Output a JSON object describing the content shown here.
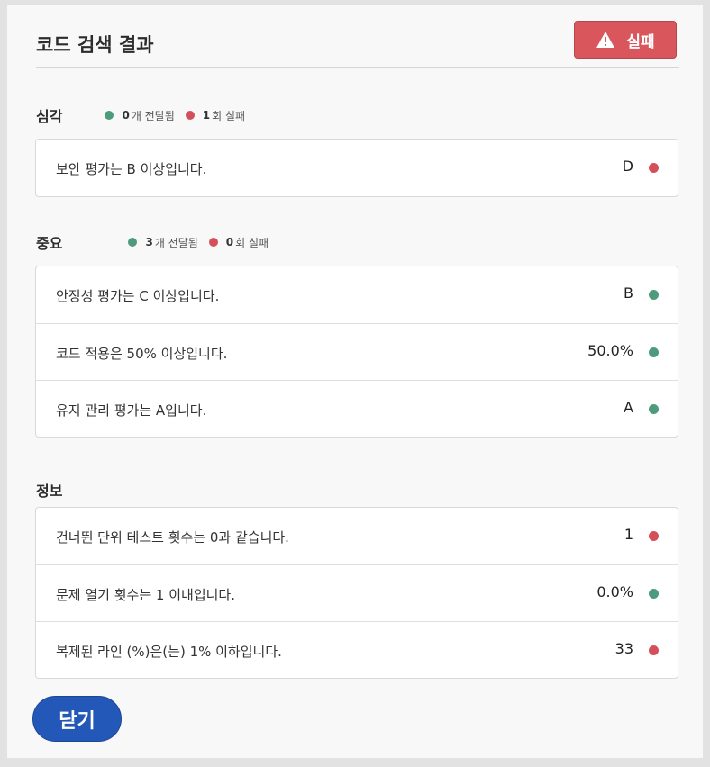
{
  "dialog": {
    "title": "코드 검색 결과",
    "status_badge": "실패",
    "close_label": "닫기"
  },
  "sections": {
    "critical": {
      "name": "심각",
      "passed_count": "0",
      "passed_text": "개 전달됨",
      "failed_count": "1",
      "failed_text": "회 실패",
      "rows": [
        {
          "label": "보안 평가는 B 이상입니다.",
          "value": "D",
          "status": "failed"
        }
      ]
    },
    "major": {
      "name": "중요",
      "passed_count": "3",
      "passed_text": " 개 전달됨",
      "failed_count": "0",
      "failed_text": " 회 실패",
      "rows": [
        {
          "label": "안정성 평가는 C 이상입니다.",
          "value": "B",
          "status": "passed"
        },
        {
          "label": "코드 적용은 50% 이상입니다.",
          "value": "50.0%",
          "status": "passed"
        },
        {
          "label": "유지 관리 평가는 A입니다.",
          "value": "A",
          "status": "passed"
        }
      ]
    },
    "info": {
      "name": "정보",
      "rows": [
        {
          "label": "건너뛴 단위 테스트 횟수는 0과 같습니다.",
          "value": "1",
          "status": "failed"
        },
        {
          "label": "문제 열기 횟수는 1 이내입니다.",
          "value": "0.0%",
          "status": "passed"
        },
        {
          "label": "복제된 라인 (%)은(는) 1% 이하입니다.",
          "value": "33",
          "status": "failed"
        }
      ]
    }
  },
  "colors": {
    "passed": "#4e9a7d",
    "failed": "#d3505a",
    "accent": "#2358b8",
    "badge": "#d9565c"
  },
  "icons": {
    "badge_icon": "warning-triangle-icon"
  }
}
